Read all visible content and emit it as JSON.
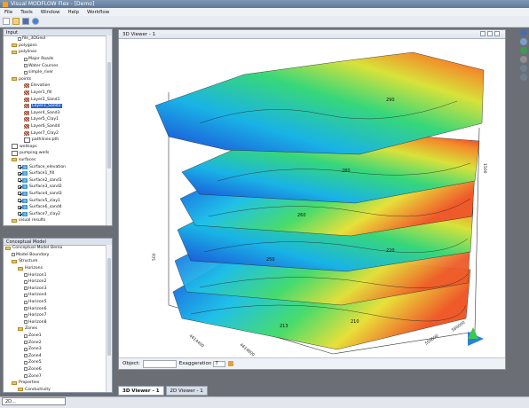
{
  "app": {
    "title": "Visual MODFLOW Flex - [Demo]"
  },
  "menu": [
    "File",
    "Tools",
    "Window",
    "Help",
    "Workflow"
  ],
  "input_panel": {
    "tab": "Input",
    "items": [
      {
        "indent": 2,
        "icon": "sq",
        "label": "file_3DGeol"
      },
      {
        "indent": 1,
        "icon": "fold",
        "label": "polygons"
      },
      {
        "indent": 1,
        "icon": "fold",
        "label": "polylines"
      },
      {
        "indent": 3,
        "icon": "sq",
        "label": "Major Roads"
      },
      {
        "indent": 3,
        "icon": "sq",
        "label": "Water Courses"
      },
      {
        "indent": 3,
        "icon": "sq",
        "label": "simple_river"
      },
      {
        "indent": 1,
        "icon": "fold",
        "label": "points"
      },
      {
        "indent": 3,
        "icon": "lay",
        "label": "Elevation"
      },
      {
        "indent": 3,
        "icon": "lay",
        "label": "Layer1_fill"
      },
      {
        "indent": 3,
        "icon": "lay",
        "label": "Layer2_Sand1"
      },
      {
        "indent": 3,
        "icon": "lay",
        "label": "Layer3_Sand2",
        "selected": true
      },
      {
        "indent": 3,
        "icon": "lay",
        "label": "Layer4_Sand3"
      },
      {
        "indent": 3,
        "icon": "lay",
        "label": "Layer5_Clay1"
      },
      {
        "indent": 3,
        "icon": "lay",
        "label": "Layer6_Sand4"
      },
      {
        "indent": 3,
        "icon": "lay",
        "label": "Layer7_Clay2"
      },
      {
        "indent": 3,
        "icon": "pt",
        "label": "pathlines.pth"
      },
      {
        "indent": 1,
        "icon": "pt",
        "label": "wellsops"
      },
      {
        "indent": 1,
        "icon": "pt",
        "label": "pumping wells"
      },
      {
        "indent": 1,
        "icon": "fold",
        "label": "surfaces"
      },
      {
        "indent": 2,
        "icon": "surf",
        "check": true,
        "label": "Surface_elevation"
      },
      {
        "indent": 2,
        "icon": "surf",
        "check": true,
        "label": "Surface1_fill"
      },
      {
        "indent": 2,
        "icon": "surf",
        "check": true,
        "label": "Surface2_sand1"
      },
      {
        "indent": 2,
        "icon": "surf",
        "check": true,
        "label": "Surface3_sand2"
      },
      {
        "indent": 2,
        "icon": "surf",
        "check": true,
        "label": "Surface4_sand3"
      },
      {
        "indent": 2,
        "icon": "surf",
        "check": true,
        "label": "Surface5_clay1"
      },
      {
        "indent": 2,
        "icon": "surf",
        "check": true,
        "label": "Surface6_sand4"
      },
      {
        "indent": 2,
        "icon": "surf",
        "check": true,
        "label": "Surface7_clay2"
      },
      {
        "indent": 1,
        "icon": "fold",
        "label": "visual results"
      }
    ]
  },
  "model_panel": {
    "tab": "Conceptual Model",
    "items": [
      {
        "indent": 0,
        "icon": "fold",
        "label": "Conceptual Model Demo"
      },
      {
        "indent": 1,
        "icon": "sq",
        "label": "Model Boundary"
      },
      {
        "indent": 1,
        "icon": "fold",
        "label": "Structure"
      },
      {
        "indent": 2,
        "icon": "fold",
        "label": "Horizons"
      },
      {
        "indent": 3,
        "icon": "sq",
        "label": "Horizon1"
      },
      {
        "indent": 3,
        "icon": "sq",
        "label": "Horizon2"
      },
      {
        "indent": 3,
        "icon": "sq",
        "label": "Horizon3"
      },
      {
        "indent": 3,
        "icon": "sq",
        "label": "Horizon4"
      },
      {
        "indent": 3,
        "icon": "sq",
        "label": "Horizon5"
      },
      {
        "indent": 3,
        "icon": "sq",
        "label": "Horizon6"
      },
      {
        "indent": 3,
        "icon": "sq",
        "label": "Horizon7"
      },
      {
        "indent": 3,
        "icon": "sq",
        "label": "Horizon8"
      },
      {
        "indent": 2,
        "icon": "fold",
        "label": "Zones"
      },
      {
        "indent": 3,
        "icon": "sq",
        "label": "Zone1"
      },
      {
        "indent": 3,
        "icon": "sq",
        "label": "Zone2"
      },
      {
        "indent": 3,
        "icon": "sq",
        "label": "Zone3"
      },
      {
        "indent": 3,
        "icon": "sq",
        "label": "Zone4"
      },
      {
        "indent": 3,
        "icon": "sq",
        "label": "Zone5"
      },
      {
        "indent": 3,
        "icon": "sq",
        "label": "Zone6"
      },
      {
        "indent": 3,
        "icon": "sq",
        "label": "Zone7"
      },
      {
        "indent": 1,
        "icon": "fold",
        "label": "Properties"
      },
      {
        "indent": 2,
        "icon": "fold",
        "label": "Conductivity"
      }
    ]
  },
  "viewer": {
    "title": "3D Viewer - 1",
    "object_label": "Object:",
    "exaggeration_label": "Exaggeration",
    "exaggeration_value": "7",
    "contour_labels": [
      "290",
      "280",
      "260",
      "250",
      "220",
      "213",
      "210"
    ],
    "axis_labels": [
      "4614400",
      "4614800",
      "559600",
      "560000",
      "1500",
      "500"
    ]
  },
  "tabs": [
    "3D Viewer - 1",
    "2D Viewer - 1"
  ],
  "statusbar": {
    "label": "2D..."
  }
}
